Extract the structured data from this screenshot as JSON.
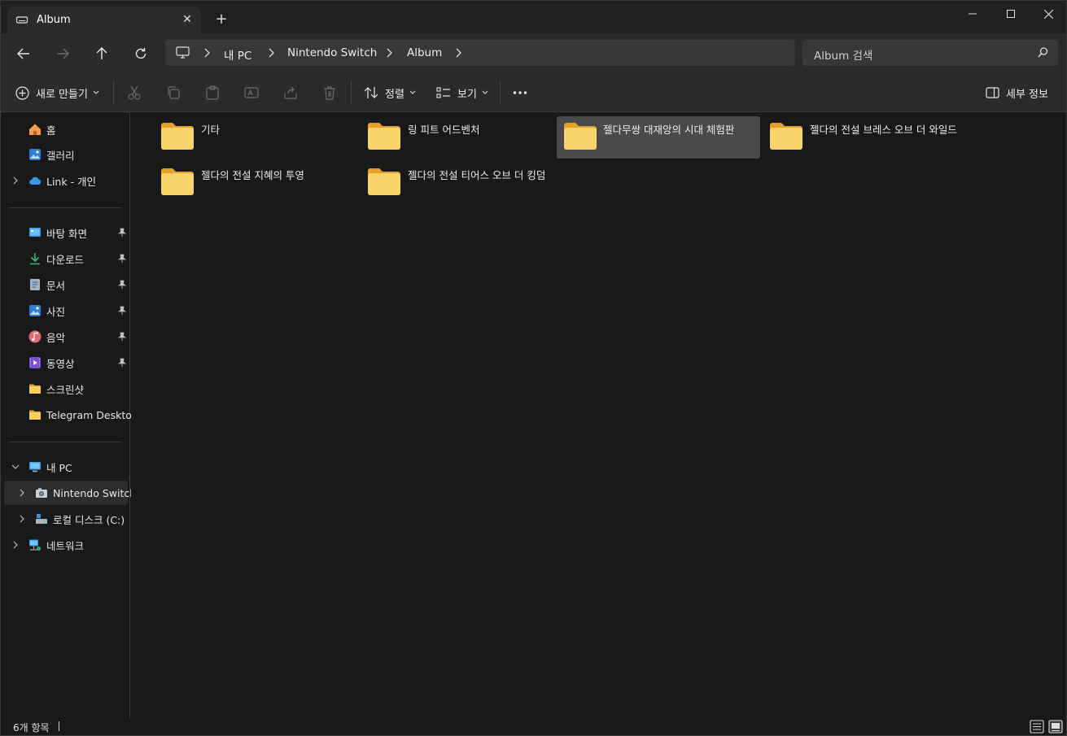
{
  "window": {
    "tab_title": "Album",
    "new_tab_label": "+",
    "close_tab_label": "✕"
  },
  "nav": {
    "breadcrumbs": [
      "내 PC",
      "Nintendo Switch",
      "Album"
    ],
    "search_placeholder": "Album 검색"
  },
  "toolbar": {
    "new_label": "새로 만들기",
    "sort_label": "정렬",
    "view_label": "보기",
    "details_label": "세부 정보"
  },
  "sidebar": {
    "home": "홈",
    "gallery": "갤러리",
    "onedrive": "Link - 개인",
    "quick": [
      "바탕 화면",
      "다운로드",
      "문서",
      "사진",
      "음악",
      "동영상",
      "스크린샷",
      "Telegram Desktop"
    ],
    "this_pc": "내 PC",
    "nintendo": "Nintendo Switch",
    "local_disk": "로컬 디스크 (C:)",
    "network": "네트워크"
  },
  "folders": [
    {
      "name": "기타"
    },
    {
      "name": "링 피트 어드벤처"
    },
    {
      "name": "젤다무쌍 대재앙의 시대 체험판",
      "selected": true
    },
    {
      "name": "젤다의 전설 브레스 오브 더 와일드"
    },
    {
      "name": "젤다의 전설 지혜의 투영"
    },
    {
      "name": "젤다의 전설 티어스 오브 더 킹덤"
    }
  ],
  "status": {
    "item_count": "6개 항목"
  },
  "colors": {
    "background": "#191919",
    "toolbar": "#2b2b2b",
    "folder": "#f4c64b",
    "selection": "#4a4a4a"
  }
}
